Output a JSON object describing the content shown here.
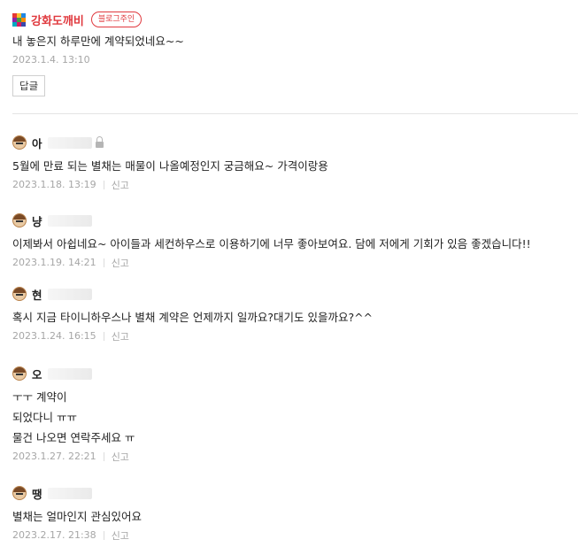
{
  "owner_comment": {
    "name": "강화도깨비",
    "badge": "블로그주인",
    "text": "내 놓은지 하루만에 계약되었네요~~",
    "date": "2023.1.4. 13:10",
    "reply_label": "답글"
  },
  "comments": [
    {
      "name": "아",
      "secret": true,
      "lines": [
        "5월에 만료 되는 별채는 매물이 나올예정인지 궁금해요~ 가격이랑용"
      ],
      "date": "2023.1.18. 13:19",
      "report_label": "신고"
    },
    {
      "name": "냥",
      "lines": [
        "이제봐서 아쉽네요~ 아이들과 세컨하우스로 이용하기에 너무 좋아보여요. 담에 저에게 기회가 있음 좋겠습니다!!"
      ],
      "date": "2023.1.19. 14:21",
      "report_label": "신고"
    },
    {
      "name": "현",
      "lines": [
        "혹시 지금 타이니하우스나 별채 계약은 언제까지 일까요?대기도 있을까요?^^"
      ],
      "date": "2023.1.24. 16:15",
      "report_label": "신고"
    },
    {
      "name": "오",
      "lines": [
        "ㅜㅜ 계약이",
        "되었다니 ㅠㅠ",
        "물건 나오면 연락주세요 ㅠ"
      ],
      "date": "2023.1.27. 22:21",
      "report_label": "신고"
    },
    {
      "name": "땡",
      "lines": [
        "별채는 얼마인지 관심있어요"
      ],
      "date": "2023.2.17. 21:38",
      "report_label": "신고"
    }
  ],
  "icons": {
    "avatar": "default-avatar-icon",
    "secret": "lock-icon",
    "logo": "rainbow-blocks-logo"
  },
  "colors": {
    "owner_name": "#e0393e",
    "date": "#a6a6a6",
    "divider": "#e4e4e4"
  }
}
